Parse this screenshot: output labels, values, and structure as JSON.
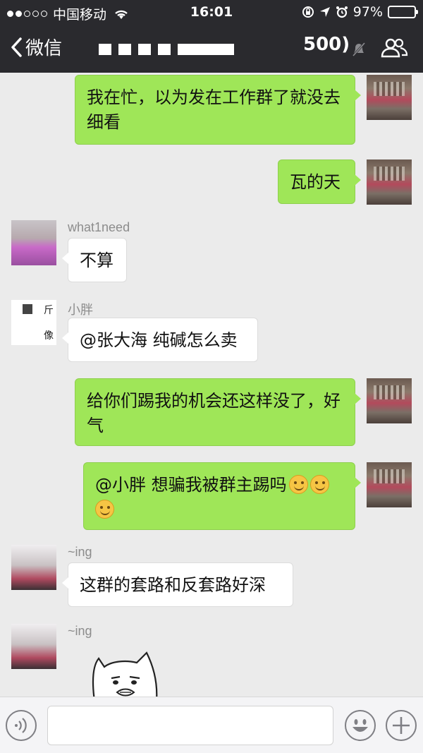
{
  "status_bar": {
    "carrier": "中国移动",
    "time": "16:01",
    "battery_percent": "97%",
    "battery_level": 0.97
  },
  "nav": {
    "back_label": "微信",
    "member_count_partial": "500)",
    "icons": [
      "back-chevron-icon",
      "mute-bell-icon",
      "group-members-icon"
    ]
  },
  "messages": [
    {
      "side": "right",
      "text": "我在忙，以为发在工作群了就没去细看"
    },
    {
      "side": "right",
      "text": "瓦的天"
    },
    {
      "side": "left",
      "sender": "what1need",
      "text": "不算"
    },
    {
      "side": "left",
      "sender": "小胖",
      "avatar_text": [
        "斤",
        "像"
      ],
      "text": "@张大海 纯碱怎么卖"
    },
    {
      "side": "right",
      "text": "给你们踢我的机会还这样没了，好气"
    },
    {
      "side": "right",
      "text": "@小胖 想骗我被群主踢吗",
      "emoji": [
        "smile-emoji",
        "smile-emoji",
        "smile-emoji"
      ]
    },
    {
      "side": "left",
      "sender": "~ing",
      "text": "这群的套路和反套路好深"
    },
    {
      "side": "left",
      "sender": "~ing",
      "sticker": "cat-face-sticker"
    }
  ],
  "input_bar": {
    "icons": [
      "voice-icon",
      "emoji-icon",
      "plus-icon"
    ]
  },
  "colors": {
    "nav_bg": "#2a2a2e",
    "chat_bg": "#ebebeb",
    "self_bubble": "#9fe658",
    "other_bubble": "#ffffff"
  }
}
